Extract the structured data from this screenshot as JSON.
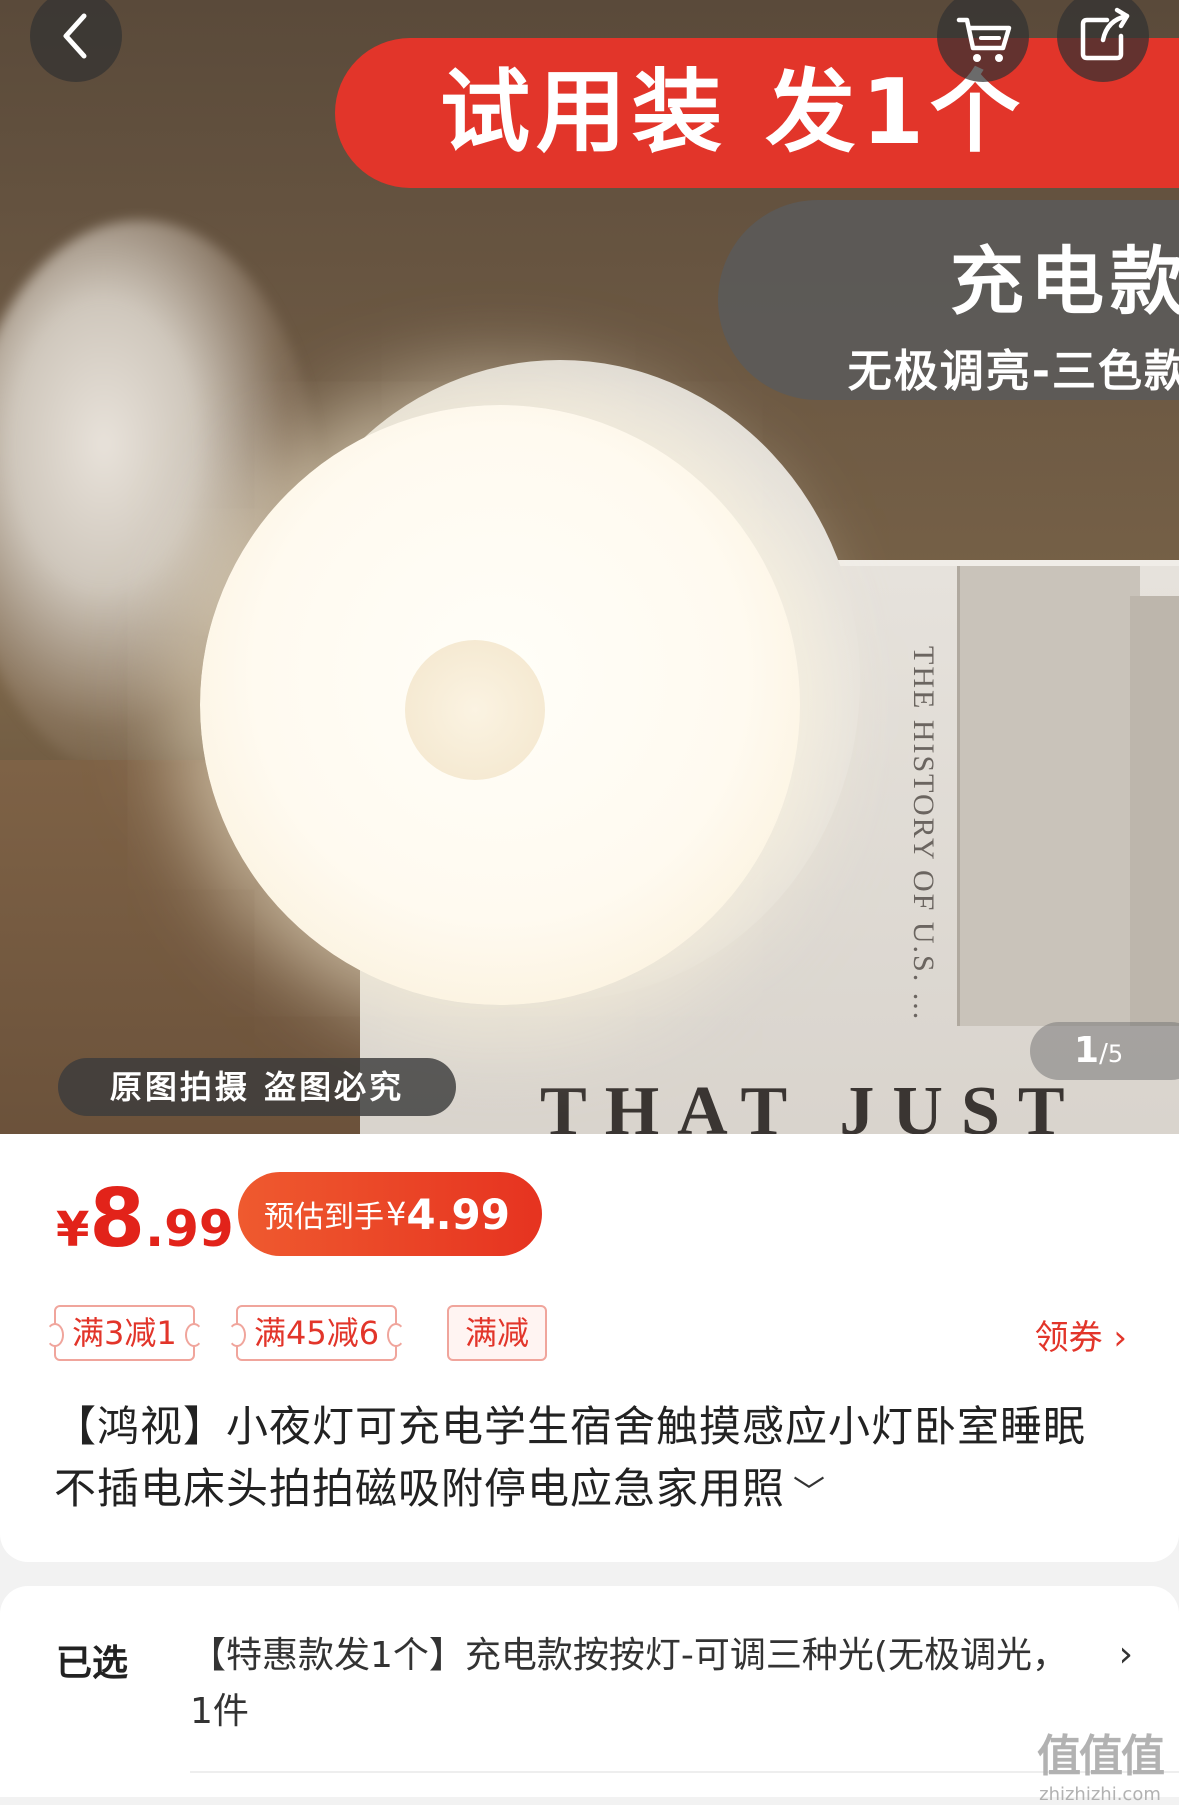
{
  "hero": {
    "banner_main": "试用装 发1个",
    "banner_sub_title": "充电款",
    "banner_sub_desc": "无极调亮-三色款",
    "watermark": "原图拍摄 盗图必究",
    "book_spine_text": "THE HISTORY OF U.S. ...",
    "book_bottom_text": "THAT JUST",
    "page_current": "1",
    "page_separator": "/",
    "page_total": "5"
  },
  "nav": {
    "back_icon": "chevron-left-icon",
    "cart_icon": "cart-icon",
    "share_icon": "share-icon"
  },
  "price": {
    "currency": "¥",
    "integer": "8",
    "decimal": ".99",
    "estimate_label": "预估到手",
    "estimate_currency": "¥",
    "estimate_value": "4.99"
  },
  "coupons": {
    "c1": "满3减1",
    "c2": "满45减6",
    "c3": "满减",
    "get_coupon": "领券 ›"
  },
  "product": {
    "title": "【鸿视】小夜灯可充电学生宿舍触摸感应小灯卧室睡眠不插电床头拍拍磁吸附停电应急家用照",
    "expand_icon": "﹀"
  },
  "spec": {
    "label": "已选",
    "value": "【特惠款发1个】充电款按按灯-可调三种光(无极调光，1件",
    "arrow": "›"
  },
  "site_watermark": {
    "mark": "值值值",
    "url": "zhizhizhi.com"
  },
  "colors": {
    "accent": "#e2352a",
    "price_red": "#e2231a"
  }
}
